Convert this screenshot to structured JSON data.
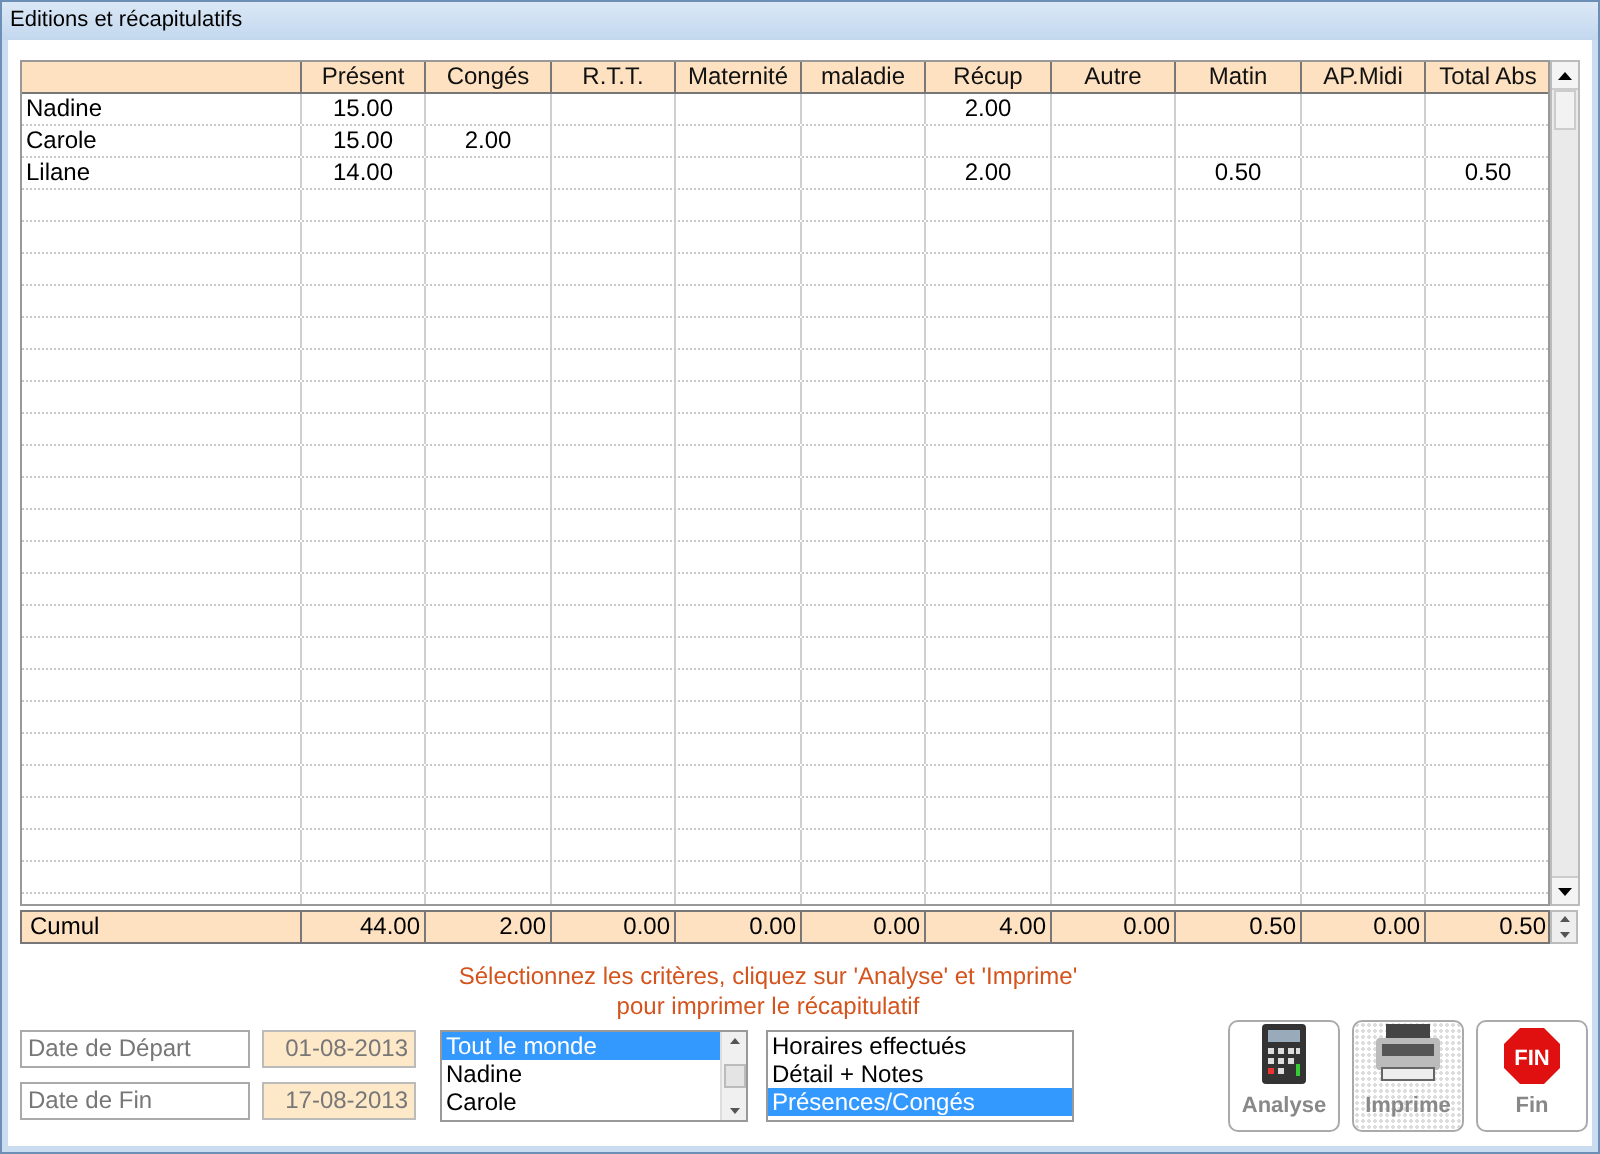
{
  "window": {
    "title": "Editions et récapitulatifs"
  },
  "table": {
    "columns": [
      "",
      "Présent",
      "Congés",
      "R.T.T.",
      "Maternité",
      "maladie",
      "Récup",
      "Autre",
      "Matin",
      "AP.Midi",
      "Total Abs"
    ],
    "rows": [
      {
        "cells": [
          "Nadine",
          "15.00",
          null,
          null,
          null,
          null,
          "2.00",
          null,
          null,
          null,
          null
        ]
      },
      {
        "cells": [
          "Carole",
          "15.00",
          "2.00",
          null,
          null,
          null,
          null,
          null,
          null,
          null,
          null
        ]
      },
      {
        "cells": [
          "Lilane",
          "14.00",
          null,
          null,
          null,
          null,
          "2.00",
          null,
          "0.50",
          null,
          "0.50"
        ]
      }
    ],
    "totals": {
      "cells": [
        "Cumul",
        "44.00",
        "2.00",
        "0.00",
        "0.00",
        "0.00",
        "4.00",
        "0.00",
        "0.50",
        "0.00",
        "0.50"
      ]
    }
  },
  "message": [
    "Sélectionnez les critères, cliquez sur 'Analyse' et 'Imprime'",
    "pour imprimer le récapitulatif"
  ],
  "dates": [
    {
      "label": "Date de Départ",
      "value": "01-08-2013"
    },
    {
      "label": "Date de Fin",
      "value": "17-08-2013"
    }
  ],
  "people": [
    {
      "label": "Tout le monde",
      "selected": true
    },
    {
      "label": "Nadine",
      "selected": false
    },
    {
      "label": "Carole",
      "selected": false
    }
  ],
  "reports": [
    {
      "label": "Horaires effectués",
      "selected": false
    },
    {
      "label": "Détail + Notes",
      "selected": false
    },
    {
      "label": "Présences/Congés",
      "selected": true
    }
  ],
  "buttons": [
    {
      "kind": "calculator",
      "label": "Analyse"
    },
    {
      "kind": "printer",
      "label": "Imprime"
    },
    {
      "kind": "stop",
      "label": "Fin",
      "icon_text": "FIN"
    }
  ]
}
